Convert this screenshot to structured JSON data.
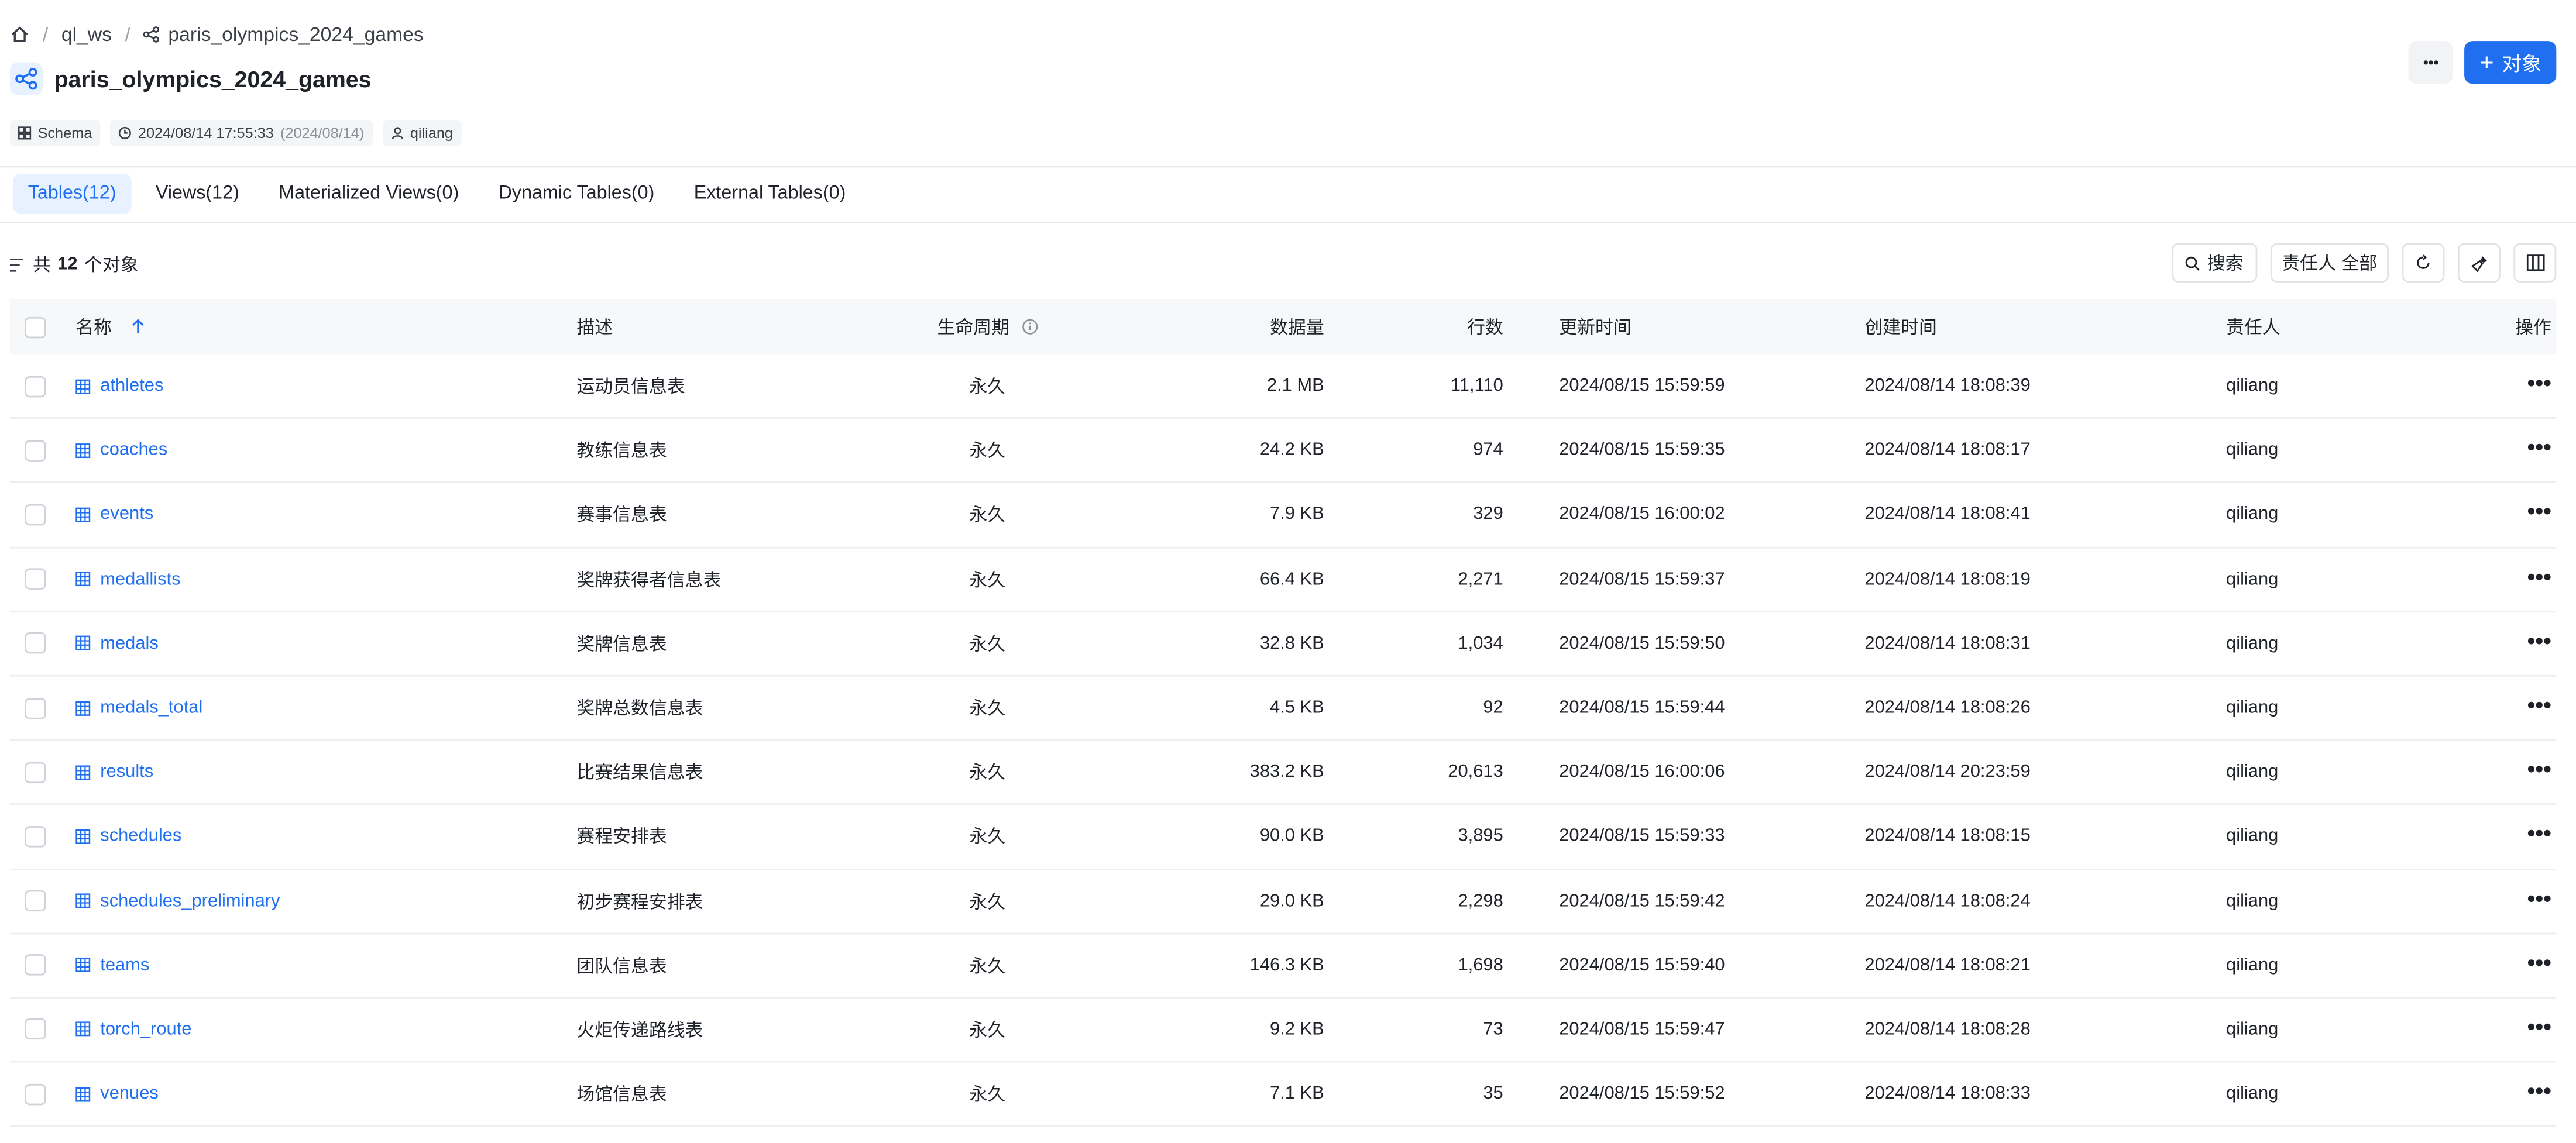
{
  "breadcrumb": {
    "workspace": "ql_ws",
    "schema": "paris_olympics_2024_games",
    "separator": "/"
  },
  "page": {
    "title": "paris_olympics_2024_games",
    "type_chip": "Schema",
    "timestamp": "2024/08/14 17:55:33",
    "timestamp_date": "(2024/08/14)",
    "owner": "qiliang"
  },
  "actions": {
    "more_label": "•••",
    "add_object_label": "对象",
    "add_icon": "+"
  },
  "tabs": [
    {
      "label": "Tables(12)",
      "active": true
    },
    {
      "label": "Views(12)",
      "active": false
    },
    {
      "label": "Materialized Views(0)",
      "active": false
    },
    {
      "label": "Dynamic Tables(0)",
      "active": false
    },
    {
      "label": "External Tables(0)",
      "active": false
    }
  ],
  "summary": {
    "prefix": "共",
    "count": "12",
    "suffix": "个对象"
  },
  "toolbar": {
    "search_label": "搜索",
    "owner_filter_label": "责任人 全部"
  },
  "table": {
    "columns": {
      "name": "名称",
      "description": "描述",
      "lifecycle": "生命周期",
      "size": "数据量",
      "rows": "行数",
      "updated": "更新时间",
      "created": "创建时间",
      "owner": "责任人",
      "ops": "操作"
    },
    "rows": [
      {
        "name": "athletes",
        "description": "运动员信息表",
        "lifecycle": "永久",
        "size": "2.1 MB",
        "rows": "11,110",
        "updated": "2024/08/15 15:59:59",
        "created": "2024/08/14 18:08:39",
        "owner": "qiliang"
      },
      {
        "name": "coaches",
        "description": "教练信息表",
        "lifecycle": "永久",
        "size": "24.2 KB",
        "rows": "974",
        "updated": "2024/08/15 15:59:35",
        "created": "2024/08/14 18:08:17",
        "owner": "qiliang"
      },
      {
        "name": "events",
        "description": "赛事信息表",
        "lifecycle": "永久",
        "size": "7.9 KB",
        "rows": "329",
        "updated": "2024/08/15 16:00:02",
        "created": "2024/08/14 18:08:41",
        "owner": "qiliang"
      },
      {
        "name": "medallists",
        "description": "奖牌获得者信息表",
        "lifecycle": "永久",
        "size": "66.4 KB",
        "rows": "2,271",
        "updated": "2024/08/15 15:59:37",
        "created": "2024/08/14 18:08:19",
        "owner": "qiliang"
      },
      {
        "name": "medals",
        "description": "奖牌信息表",
        "lifecycle": "永久",
        "size": "32.8 KB",
        "rows": "1,034",
        "updated": "2024/08/15 15:59:50",
        "created": "2024/08/14 18:08:31",
        "owner": "qiliang"
      },
      {
        "name": "medals_total",
        "description": "奖牌总数信息表",
        "lifecycle": "永久",
        "size": "4.5 KB",
        "rows": "92",
        "updated": "2024/08/15 15:59:44",
        "created": "2024/08/14 18:08:26",
        "owner": "qiliang"
      },
      {
        "name": "results",
        "description": "比赛结果信息表",
        "lifecycle": "永久",
        "size": "383.2 KB",
        "rows": "20,613",
        "updated": "2024/08/15 16:00:06",
        "created": "2024/08/14 20:23:59",
        "owner": "qiliang"
      },
      {
        "name": "schedules",
        "description": "赛程安排表",
        "lifecycle": "永久",
        "size": "90.0 KB",
        "rows": "3,895",
        "updated": "2024/08/15 15:59:33",
        "created": "2024/08/14 18:08:15",
        "owner": "qiliang"
      },
      {
        "name": "schedules_preliminary",
        "description": "初步赛程安排表",
        "lifecycle": "永久",
        "size": "29.0 KB",
        "rows": "2,298",
        "updated": "2024/08/15 15:59:42",
        "created": "2024/08/14 18:08:24",
        "owner": "qiliang"
      },
      {
        "name": "teams",
        "description": "团队信息表",
        "lifecycle": "永久",
        "size": "146.3 KB",
        "rows": "1,698",
        "updated": "2024/08/15 15:59:40",
        "created": "2024/08/14 18:08:21",
        "owner": "qiliang"
      },
      {
        "name": "torch_route",
        "description": "火炬传递路线表",
        "lifecycle": "永久",
        "size": "9.2 KB",
        "rows": "73",
        "updated": "2024/08/15 15:59:47",
        "created": "2024/08/14 18:08:28",
        "owner": "qiliang"
      },
      {
        "name": "venues",
        "description": "场馆信息表",
        "lifecycle": "永久",
        "size": "7.1 KB",
        "rows": "35",
        "updated": "2024/08/15 15:59:52",
        "created": "2024/08/14 18:08:33",
        "owner": "qiliang"
      }
    ]
  },
  "colors": {
    "accent": "#1f6ff0",
    "tab_active_bg": "#e8f1ff",
    "header_bg": "#f7f8fa"
  },
  "icons": {
    "home": "home-icon",
    "schema": "schema-share-icon",
    "clock": "clock-icon",
    "user": "user-icon",
    "list": "list-icon",
    "search": "search-icon",
    "refresh": "refresh-icon",
    "clean": "clean-brush-icon",
    "columns": "columns-icon",
    "table": "table-grid-icon",
    "sort": "sort-ascending-icon",
    "info": "info-icon"
  }
}
